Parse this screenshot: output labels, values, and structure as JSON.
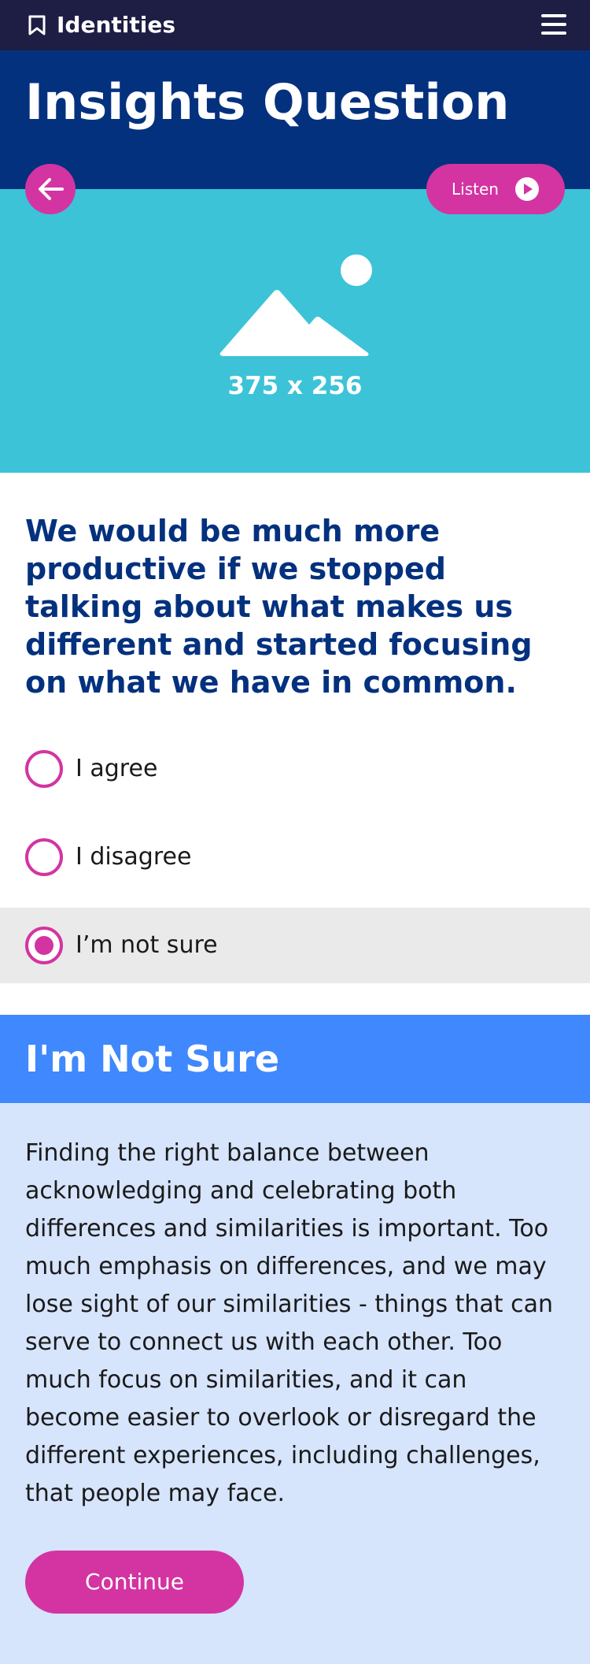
{
  "app": {
    "brand": "Identities",
    "icons": {
      "bookmark": "bookmark-icon",
      "menu": "hamburger-menu-icon"
    }
  },
  "header": {
    "title": "Insights Question"
  },
  "hero": {
    "listen_label": "Listen",
    "image_placeholder_label": "375 x 256",
    "icons": {
      "back": "arrow-left-icon",
      "listen": "play-icon",
      "image": "image-placeholder-icon"
    }
  },
  "question": {
    "text": "We would be much more productive if we stopped talking about what makes us different and started focusing on what we have in common.",
    "options": [
      {
        "label": "I agree",
        "selected": false
      },
      {
        "label": "I disagree",
        "selected": false
      },
      {
        "label": "I’m not sure",
        "selected": true
      }
    ]
  },
  "answer": {
    "title": "I'm Not Sure",
    "body": "Finding the right balance between acknowledging and celebrating both differences and similarities is important. Too much emphasis on differences, and we may lose sight of our similarities - things that can serve to connect us with each other. Too much focus on similarities, and it can become easier to overlook or disregard the different experiences, including challenges, that people may face.",
    "continue_label": "Continue"
  },
  "colors": {
    "topbar": "#1e1d44",
    "header": "#04317e",
    "hero": "#3cc3d8",
    "accent": "#d334a2",
    "answer_header": "#3f88fd",
    "answer_body": "#d6e4fc",
    "selected_row": "#eaeaea"
  }
}
